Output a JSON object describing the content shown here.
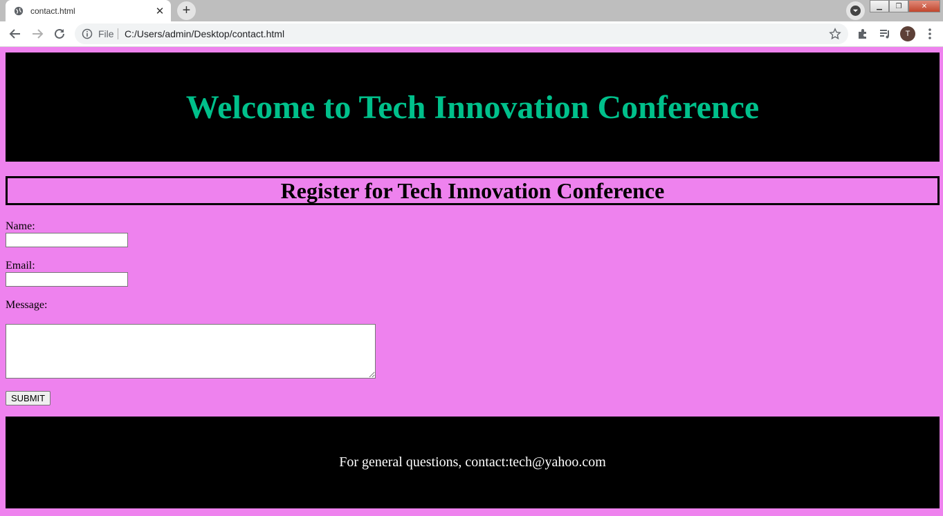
{
  "browser": {
    "tab_title": "contact.html",
    "new_tab_symbol": "+",
    "address_scheme": "File",
    "address_url": "C:/Users/admin/Desktop/contact.html",
    "profile_initial": "T",
    "icons": [
      "globe-icon",
      "close-icon",
      "back-icon",
      "forward-icon",
      "reload-icon",
      "info-icon",
      "star-icon",
      "extensions-icon",
      "reading-list-icon",
      "menu-icon"
    ]
  },
  "header": {
    "title": "Welcome to Tech Innovation Conference"
  },
  "form": {
    "heading": "Register for Tech Innovation Conference",
    "name_label": "Name:",
    "email_label": "Email:",
    "message_label": "Message:",
    "submit_label": "SUBMIT"
  },
  "footer": {
    "text": "For general questions, contact:tech@yahoo.com"
  },
  "colors": {
    "page_background": "#ee82ee",
    "header_background": "#000000",
    "header_text": "#00c08b",
    "footer_text": "#ffffff"
  }
}
